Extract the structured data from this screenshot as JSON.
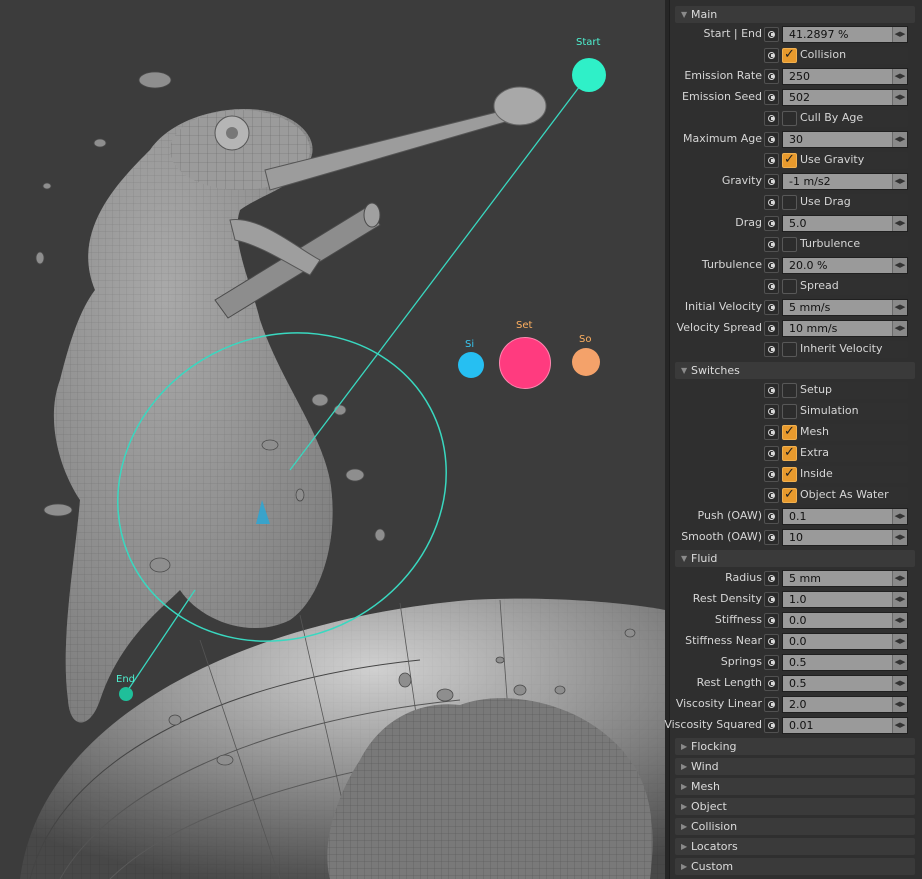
{
  "viewport": {
    "markers": {
      "start": "Start",
      "end": "End",
      "set": "Set",
      "si": "Si",
      "so": "So"
    },
    "colors": {
      "start": "#2ff0c8",
      "end": "#1fbf9a",
      "set": "#ff3b7f",
      "si": "#26bff2",
      "so": "#f4a26a",
      "guide": "#39d8c0"
    }
  },
  "panel": {
    "sections": {
      "main": "Main",
      "switches": "Switches",
      "fluid": "Fluid",
      "collapsed": [
        "Flocking",
        "Wind",
        "Mesh",
        "Object",
        "Collision",
        "Locators",
        "Custom"
      ]
    },
    "main_rows": [
      {
        "type": "field",
        "label": "Start | End",
        "value": "41.2897 %"
      },
      {
        "type": "check",
        "label": "Collision",
        "checked": true
      },
      {
        "type": "field",
        "label": "Emission Rate",
        "value": "250"
      },
      {
        "type": "field",
        "label": "Emission Seed",
        "value": "502"
      },
      {
        "type": "check",
        "label": "Cull By Age",
        "checked": false
      },
      {
        "type": "field",
        "label": "Maximum Age",
        "value": "30"
      },
      {
        "type": "check",
        "label": "Use Gravity",
        "checked": true
      },
      {
        "type": "field",
        "label": "Gravity",
        "value": "-1 m/s2"
      },
      {
        "type": "check",
        "label": "Use Drag",
        "checked": false
      },
      {
        "type": "field",
        "label": "Drag",
        "value": "5.0"
      },
      {
        "type": "check",
        "label": "Turbulence",
        "checked": false
      },
      {
        "type": "field",
        "label": "Turbulence",
        "value": "20.0 %"
      },
      {
        "type": "check",
        "label": "Spread",
        "checked": false
      },
      {
        "type": "field",
        "label": "Initial Velocity",
        "value": "5 mm/s"
      },
      {
        "type": "field",
        "label": "Velocity Spread",
        "value": "10 mm/s"
      },
      {
        "type": "check",
        "label": "Inherit Velocity",
        "checked": false
      }
    ],
    "switch_rows": [
      {
        "type": "check",
        "label": "Setup",
        "checked": false
      },
      {
        "type": "check",
        "label": "Simulation",
        "checked": false
      },
      {
        "type": "check",
        "label": "Mesh",
        "checked": true
      },
      {
        "type": "check",
        "label": "Extra",
        "checked": true
      },
      {
        "type": "check",
        "label": "Inside",
        "checked": true
      },
      {
        "type": "check",
        "label": "Object As Water",
        "checked": true
      },
      {
        "type": "field",
        "label": "Push (OAW)",
        "value": "0.1"
      },
      {
        "type": "field",
        "label": "Smooth (OAW)",
        "value": "10"
      }
    ],
    "fluid_rows": [
      {
        "type": "field",
        "label": "Radius",
        "value": "5 mm"
      },
      {
        "type": "field",
        "label": "Rest Density",
        "value": "1.0"
      },
      {
        "type": "field",
        "label": "Stiffness",
        "value": "0.0"
      },
      {
        "type": "field",
        "label": "Stiffness Near",
        "value": "0.0"
      },
      {
        "type": "field",
        "label": "Springs",
        "value": "0.5"
      },
      {
        "type": "field",
        "label": "Rest Length",
        "value": "0.5"
      },
      {
        "type": "field",
        "label": "Viscosity Linear",
        "value": "2.0"
      },
      {
        "type": "field",
        "label": "Viscosity Squared",
        "value": "0.01"
      }
    ]
  }
}
